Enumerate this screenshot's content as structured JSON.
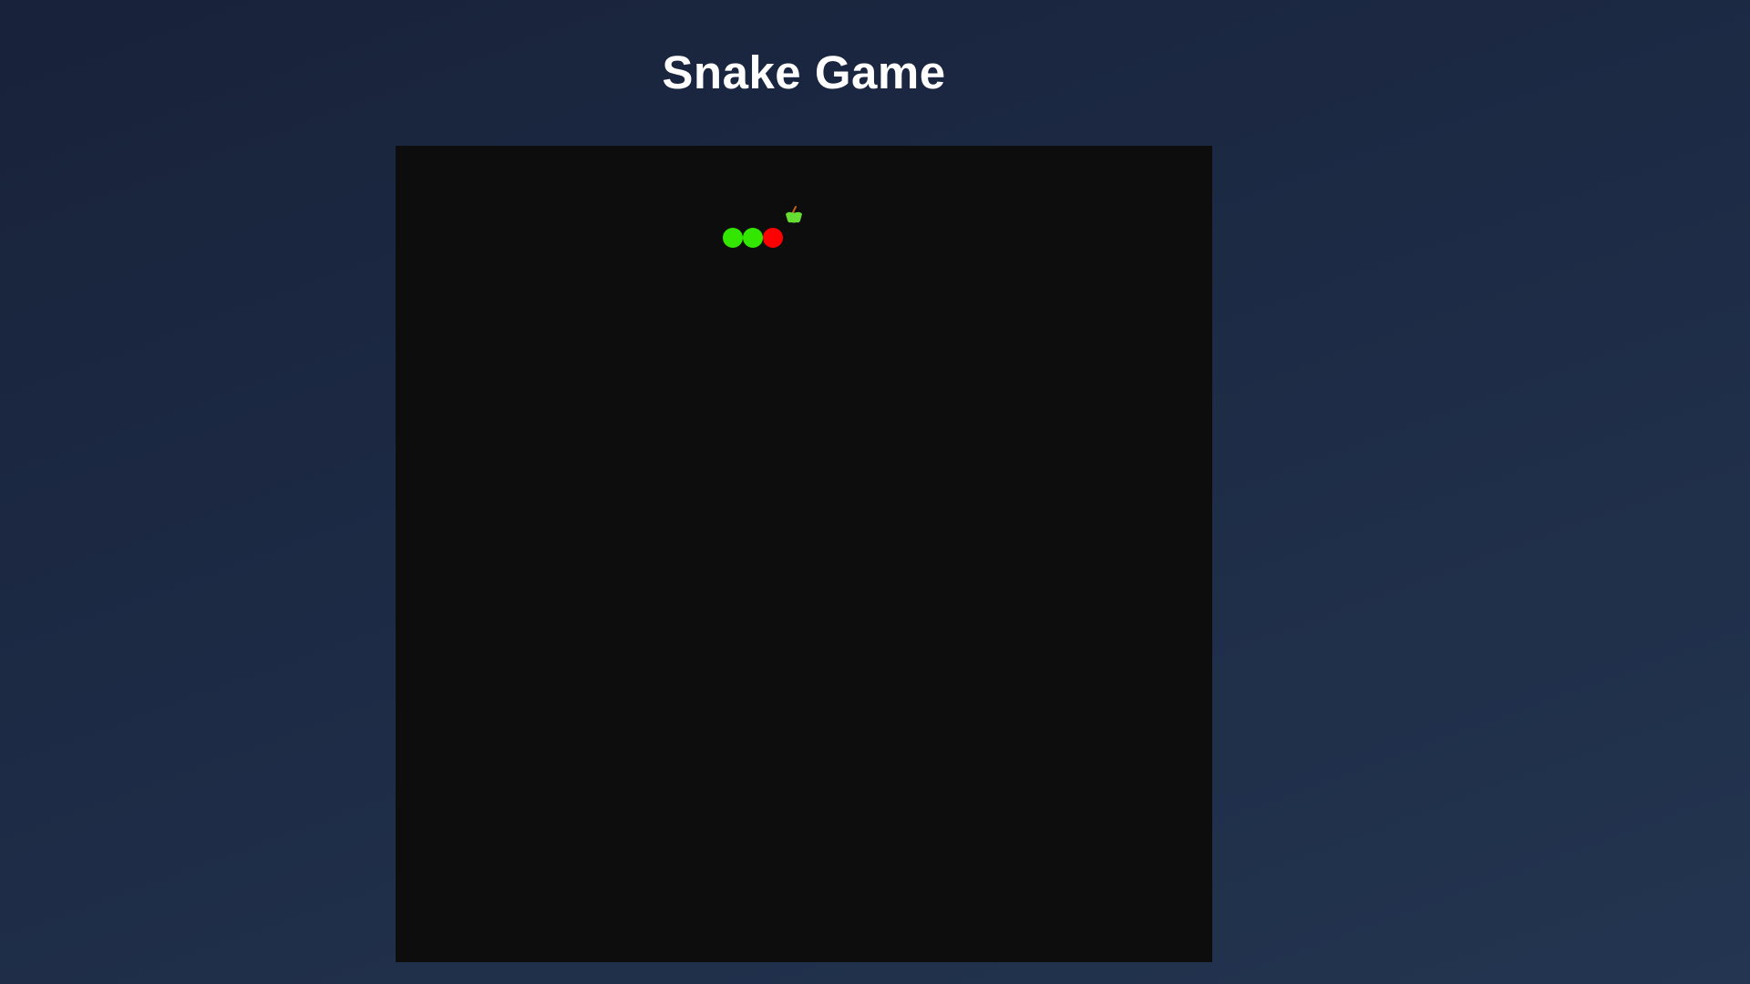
{
  "header": {
    "title": "Snake Game"
  },
  "game": {
    "grid_cols": 40,
    "grid_rows": 40,
    "snake": [
      {
        "col": 16,
        "row": 4,
        "part": "body"
      },
      {
        "col": 17,
        "row": 4,
        "part": "body"
      },
      {
        "col": 18,
        "row": 4,
        "part": "head"
      }
    ],
    "food": {
      "col": 19,
      "row": 3,
      "type": "apple-icon"
    },
    "colors": {
      "board": "#0d0d0d",
      "snake_body": "#33e600",
      "snake_head": "#ff0000",
      "food": "#66dd33",
      "food_stem": "#c2611a"
    }
  }
}
